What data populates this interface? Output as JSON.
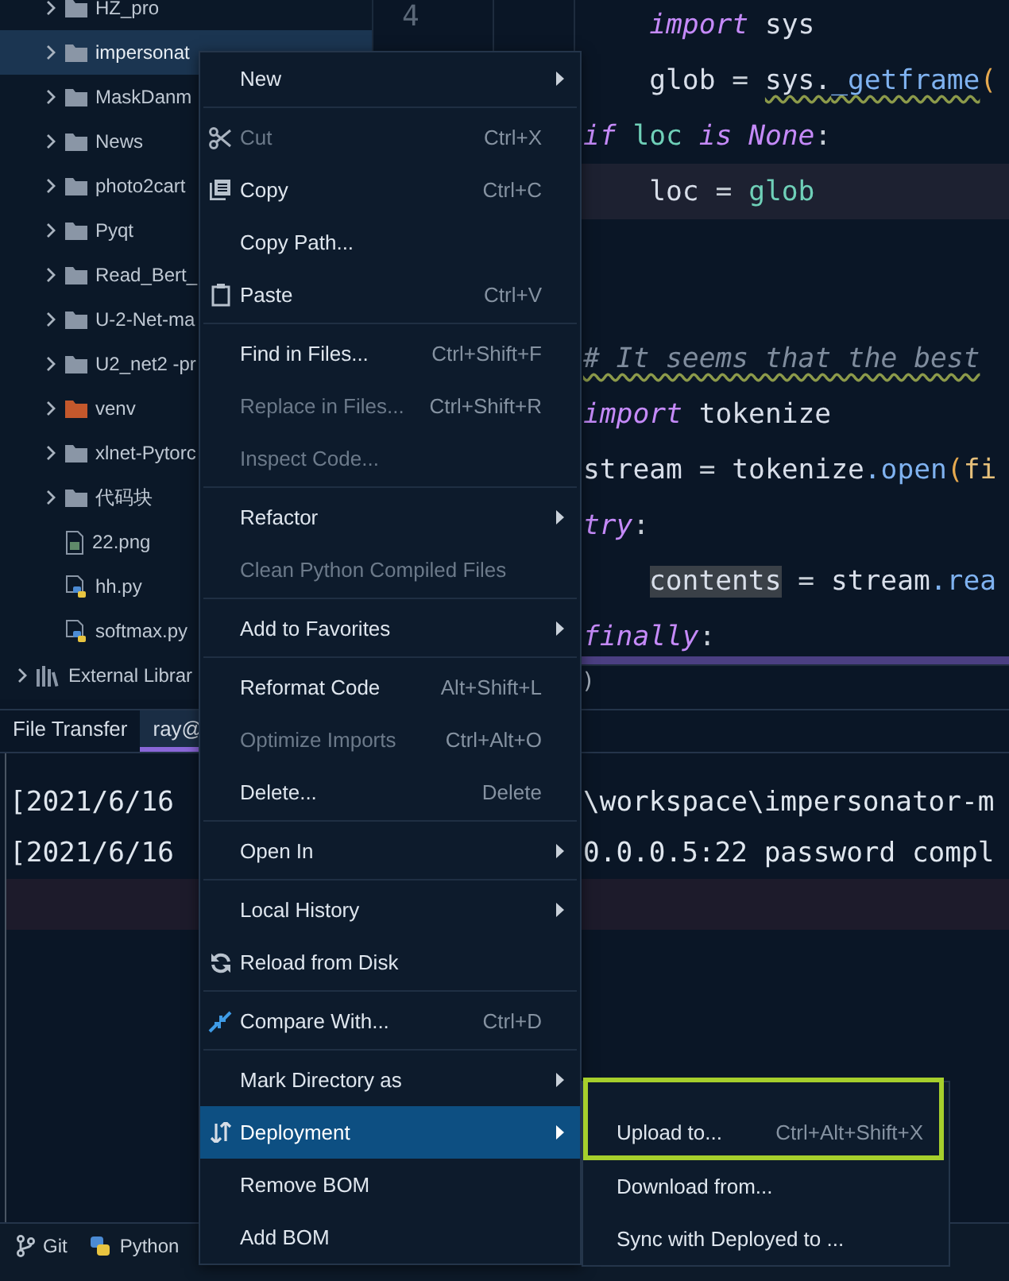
{
  "project_tree": {
    "items": [
      {
        "label": "HZ_pro",
        "kind": "folder",
        "expanded": false,
        "selected": false
      },
      {
        "label": "impersonat",
        "kind": "folder",
        "expanded": false,
        "selected": true
      },
      {
        "label": "MaskDanm",
        "kind": "folder",
        "expanded": false,
        "selected": false
      },
      {
        "label": "News",
        "kind": "folder",
        "expanded": false,
        "selected": false
      },
      {
        "label": "photo2cart",
        "kind": "folder",
        "expanded": false,
        "selected": false
      },
      {
        "label": "Pyqt",
        "kind": "folder",
        "expanded": false,
        "selected": false
      },
      {
        "label": "Read_Bert_",
        "kind": "folder",
        "expanded": false,
        "selected": false
      },
      {
        "label": "U-2-Net-ma",
        "kind": "folder",
        "expanded": false,
        "selected": false
      },
      {
        "label": "U2_net2 -pr",
        "kind": "folder",
        "expanded": false,
        "selected": false
      },
      {
        "label": "venv",
        "kind": "excluded-folder",
        "expanded": false,
        "selected": false
      },
      {
        "label": "xlnet-Pytorc",
        "kind": "folder",
        "expanded": false,
        "selected": false
      },
      {
        "label": "代码块",
        "kind": "folder",
        "expanded": false,
        "selected": false
      },
      {
        "label": "22.png",
        "kind": "image-file",
        "selected": false
      },
      {
        "label": "hh.py",
        "kind": "python-file",
        "selected": false
      },
      {
        "label": "softmax.py",
        "kind": "python-file",
        "selected": false
      },
      {
        "label": "External Librar",
        "kind": "library",
        "expanded": false,
        "selected": false
      }
    ]
  },
  "editor": {
    "line_number": "4",
    "lines": [
      {
        "kind": "code",
        "current": false,
        "tokens": [
          {
            "text": "    import",
            "kind": "keyword"
          },
          {
            "text": " sys",
            "kind": "plain"
          }
        ]
      },
      {
        "kind": "code",
        "current": false,
        "tokens": [
          {
            "text": "    glob",
            "kind": "plain"
          },
          {
            "text": " = ",
            "kind": "operator"
          },
          {
            "text": "sys.",
            "kind": "plain",
            "warned": true
          },
          {
            "text": "_getframe",
            "kind": "call",
            "warned": true
          },
          {
            "text": "(",
            "kind": "paren"
          }
        ]
      },
      {
        "kind": "code",
        "current": false,
        "tokens": [
          {
            "text": "if ",
            "kind": "keyword"
          },
          {
            "text": "loc ",
            "kind": "local"
          },
          {
            "text": "is ",
            "kind": "keyword"
          },
          {
            "text": "None",
            "kind": "keyword"
          },
          {
            "text": ":",
            "kind": "operator"
          }
        ]
      },
      {
        "kind": "code",
        "current": true,
        "tokens": [
          {
            "text": "    loc",
            "kind": "plain"
          },
          {
            "text": " = ",
            "kind": "operator"
          },
          {
            "text": "glob",
            "kind": "local"
          }
        ]
      },
      {
        "kind": "blank"
      },
      {
        "kind": "blank"
      },
      {
        "kind": "code",
        "current": false,
        "tokens": [
          {
            "text": "# It seems that the best",
            "kind": "comment",
            "warned": true
          }
        ]
      },
      {
        "kind": "code",
        "current": false,
        "tokens": [
          {
            "text": "import",
            "kind": "keyword"
          },
          {
            "text": " tokenize",
            "kind": "plain"
          }
        ]
      },
      {
        "kind": "code",
        "current": false,
        "tokens": [
          {
            "text": "stream",
            "kind": "plain"
          },
          {
            "text": " = ",
            "kind": "operator"
          },
          {
            "text": "tokenize",
            "kind": "plain"
          },
          {
            "text": ".open",
            "kind": "call"
          },
          {
            "text": "(",
            "kind": "paren"
          },
          {
            "text": "fi",
            "kind": "param"
          }
        ]
      },
      {
        "kind": "code",
        "current": false,
        "tokens": [
          {
            "text": "try",
            "kind": "keyword"
          },
          {
            "text": ":",
            "kind": "operator"
          }
        ]
      },
      {
        "kind": "indented-code",
        "current": false,
        "tokens": [
          {
            "text": "contents",
            "kind": "selected-word"
          },
          {
            "text": " = ",
            "kind": "operator"
          },
          {
            "text": "stream",
            "kind": "plain"
          },
          {
            "text": ".rea",
            "kind": "call"
          }
        ]
      },
      {
        "kind": "code",
        "current": false,
        "tokens": [
          {
            "text": "finally",
            "kind": "keyword"
          },
          {
            "text": ":",
            "kind": "operator"
          }
        ]
      }
    ],
    "bottom_text": ")"
  },
  "tool_window": {
    "tabs": [
      {
        "label": "File Transfer",
        "selected": false
      },
      {
        "label": "ray@",
        "selected": true
      }
    ],
    "terminal_lines": [
      {
        "start": "[2021/6/16",
        "end": "\\workspace\\impersonator-m",
        "current": false
      },
      {
        "start": "[2021/6/16",
        "end": "0.0.0.5:22 password compl",
        "current": false
      },
      {
        "current": true
      }
    ]
  },
  "status_bar": {
    "items": [
      {
        "label": "Git",
        "kind": "git"
      },
      {
        "label": "Python",
        "kind": "python"
      }
    ]
  },
  "context_menu": {
    "items": [
      {
        "kind": "item",
        "label": "New",
        "submenu": true,
        "disabled": false,
        "selected": false
      },
      {
        "kind": "separator"
      },
      {
        "kind": "cut",
        "label": "Cut",
        "shortcut": "Ctrl+X",
        "submenu": false,
        "disabled": true,
        "selected": false
      },
      {
        "kind": "copy",
        "label": "Copy",
        "shortcut": "Ctrl+C",
        "submenu": false,
        "disabled": false,
        "selected": false
      },
      {
        "kind": "item",
        "label": "Copy Path...",
        "submenu": false,
        "disabled": false,
        "selected": false
      },
      {
        "kind": "paste",
        "label": "Paste",
        "shortcut": "Ctrl+V",
        "submenu": false,
        "disabled": false,
        "selected": false
      },
      {
        "kind": "separator"
      },
      {
        "kind": "item",
        "label": "Find in Files...",
        "shortcut": "Ctrl+Shift+F",
        "submenu": false,
        "disabled": false,
        "selected": false
      },
      {
        "kind": "item",
        "label": "Replace in Files...",
        "shortcut": "Ctrl+Shift+R",
        "submenu": false,
        "disabled": true,
        "selected": false
      },
      {
        "kind": "item",
        "label": "Inspect Code...",
        "submenu": false,
        "disabled": true,
        "selected": false
      },
      {
        "kind": "separator"
      },
      {
        "kind": "item",
        "label": "Refactor",
        "submenu": true,
        "disabled": false,
        "selected": false
      },
      {
        "kind": "item",
        "label": "Clean Python Compiled Files",
        "submenu": false,
        "disabled": true,
        "selected": false
      },
      {
        "kind": "separator"
      },
      {
        "kind": "item",
        "label": "Add to Favorites",
        "submenu": true,
        "disabled": false,
        "selected": false
      },
      {
        "kind": "separator"
      },
      {
        "kind": "item",
        "label": "Reformat Code",
        "shortcut": "Alt+Shift+L",
        "submenu": false,
        "disabled": false,
        "selected": false
      },
      {
        "kind": "item",
        "label": "Optimize Imports",
        "shortcut": "Ctrl+Alt+O",
        "submenu": false,
        "disabled": true,
        "selected": false
      },
      {
        "kind": "item",
        "label": "Delete...",
        "shortcut": "Delete",
        "submenu": false,
        "disabled": false,
        "selected": false
      },
      {
        "kind": "separator"
      },
      {
        "kind": "item",
        "label": "Open In",
        "submenu": true,
        "disabled": false,
        "selected": false
      },
      {
        "kind": "separator"
      },
      {
        "kind": "item",
        "label": "Local History",
        "submenu": true,
        "disabled": false,
        "selected": false
      },
      {
        "kind": "reload",
        "label": "Reload from Disk",
        "submenu": false,
        "disabled": false,
        "selected": false
      },
      {
        "kind": "separator"
      },
      {
        "kind": "compare",
        "label": "Compare With...",
        "shortcut": "Ctrl+D",
        "submenu": false,
        "disabled": false,
        "selected": false
      },
      {
        "kind": "separator"
      },
      {
        "kind": "item",
        "label": "Mark Directory as",
        "submenu": true,
        "disabled": false,
        "selected": false
      },
      {
        "kind": "deployment",
        "label": "Deployment",
        "submenu": true,
        "disabled": false,
        "selected": true
      },
      {
        "kind": "item",
        "label": "Remove BOM",
        "submenu": false,
        "disabled": false,
        "selected": false
      },
      {
        "kind": "item",
        "label": "Add BOM",
        "submenu": false,
        "disabled": false,
        "selected": false
      }
    ]
  },
  "submenu": {
    "items": [
      {
        "label": "Upload to...",
        "shortcut": "Ctrl+Alt+Shift+X",
        "highlighted": true
      },
      {
        "label": "Download from...",
        "highlighted": false
      },
      {
        "label": "Sync with Deployed to ...",
        "highlighted": false
      }
    ]
  }
}
